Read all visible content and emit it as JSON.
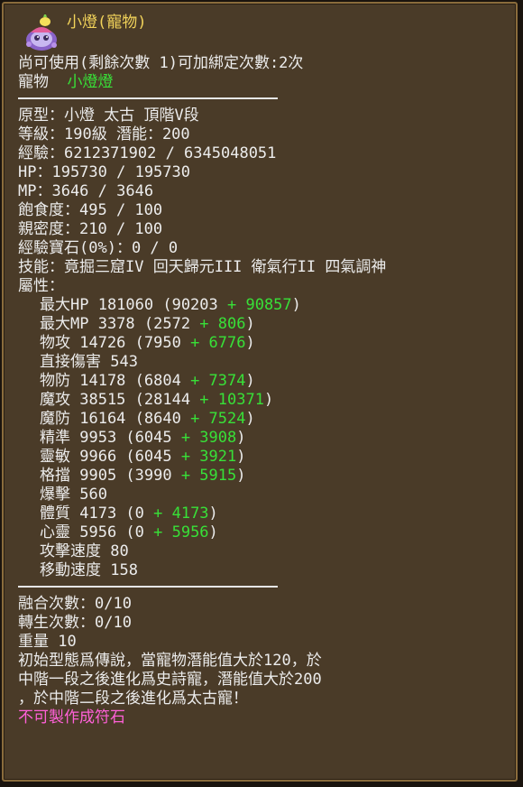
{
  "title": "小燈(寵物)",
  "status": {
    "uses_line": "尚可使用(剩餘次數 1)可加綁定次數:2次",
    "pet_label": "寵物",
    "pet_name": "小燈燈"
  },
  "basics": [
    "原型：小燈 太古 頂階V段",
    "等級：190級 潛能：200",
    "經驗：6212371902 / 6345048051",
    "HP：195730 / 195730",
    "MP：3646 / 3646",
    "飽食度：495 / 100",
    "親密度：210 / 100",
    "經驗寶石(0%)：0 / 0",
    "技能：竟掘三窟IV 回天歸元III 衛氣行II 四氣調神",
    "屬性："
  ],
  "attributes": [
    {
      "prefix": "最大HP 181060 (90203 ",
      "bonus": "+ 90857",
      "suffix": ")"
    },
    {
      "prefix": "最大MP 3378 (2572 ",
      "bonus": "+ 806",
      "suffix": ")"
    },
    {
      "prefix": "物攻 14726 (7950 ",
      "bonus": "+ 6776",
      "suffix": ")"
    },
    {
      "prefix": "直接傷害 543",
      "bonus": "",
      "suffix": ""
    },
    {
      "prefix": "物防 14178 (6804 ",
      "bonus": "+ 7374",
      "suffix": ")"
    },
    {
      "prefix": "魔攻 38515 (28144 ",
      "bonus": "+ 10371",
      "suffix": ")"
    },
    {
      "prefix": "魔防 16164 (8640 ",
      "bonus": "+ 7524",
      "suffix": ")"
    },
    {
      "prefix": "精準 9953 (6045 ",
      "bonus": "+ 3908",
      "suffix": ")"
    },
    {
      "prefix": "靈敏 9966 (6045 ",
      "bonus": "+ 3921",
      "suffix": ")"
    },
    {
      "prefix": "格擋 9905 (3990 ",
      "bonus": "+ 5915",
      "suffix": ")"
    },
    {
      "prefix": "爆擊 560",
      "bonus": "",
      "suffix": ""
    },
    {
      "prefix": "體質 4173 (0 ",
      "bonus": "+ 4173",
      "suffix": ")"
    },
    {
      "prefix": "心靈 5956 (0 ",
      "bonus": "+ 5956",
      "suffix": ")"
    },
    {
      "prefix": "攻擊速度 80",
      "bonus": "",
      "suffix": ""
    },
    {
      "prefix": "移動速度 158",
      "bonus": "",
      "suffix": ""
    }
  ],
  "footer": [
    "融合次數：0/10",
    "轉生次數：0/10",
    "重量 10",
    "初始型態爲傳說，當寵物潛能值大於120，於",
    "中階一段之後進化爲史詩寵，潛能值大於200",
    "，於中階二段之後進化爲太古寵！"
  ],
  "craft_note": "不可製作成符石",
  "colors": {
    "title": "#f2d35a",
    "bonus": "#38e038",
    "craft_note": "#ff60d8",
    "background": "#4a3b28"
  },
  "icon": "lamp-pet-icon"
}
